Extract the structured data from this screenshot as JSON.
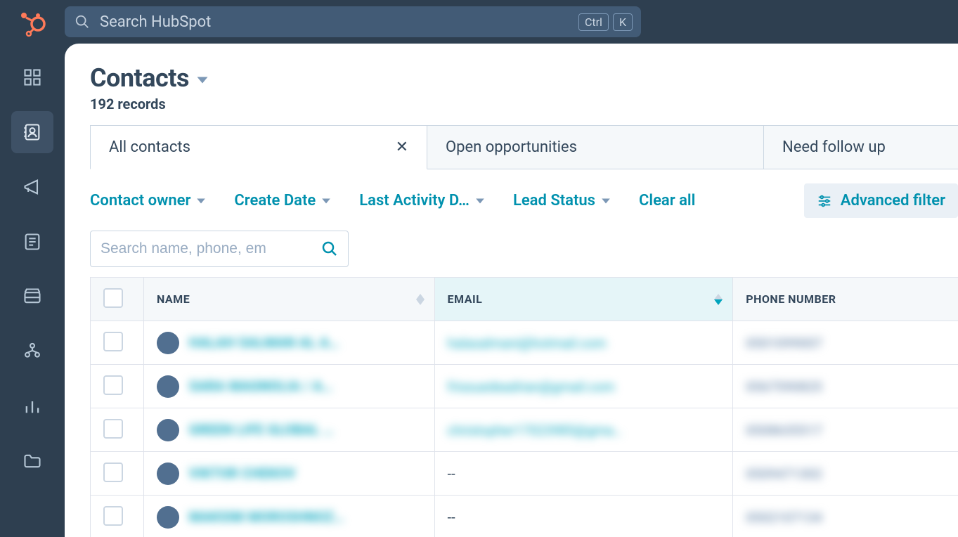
{
  "search": {
    "placeholder": "Search HubSpot",
    "kbd1": "Ctrl",
    "kbd2": "K"
  },
  "page": {
    "title": "Contacts",
    "record_count": "192 records"
  },
  "tabs": [
    {
      "label": "All contacts",
      "closable": true,
      "active": true
    },
    {
      "label": "Open opportunities",
      "closable": false,
      "active": false
    },
    {
      "label": "Need follow up",
      "closable": false,
      "active": false
    }
  ],
  "filters": {
    "f1": "Contact owner",
    "f2": "Create Date",
    "f3": "Last Activity D…",
    "f4": "Lead Status",
    "clear": "Clear all",
    "advanced": "Advanced filter"
  },
  "table_search_placeholder": "Search name, phone, em",
  "columns": {
    "name": "NAME",
    "email": "EMAIL",
    "phone": "PHONE NUMBER"
  },
  "rows": [
    {
      "name": "HALAH SALMAN AL A…",
      "email": "halasalmani@hotmail.com",
      "phone": "0501099007"
    },
    {
      "name": "SARA MAGNOLIA / A…",
      "email": "frissuedeadrian@gmail.com",
      "phone": "0567590825"
    },
    {
      "name": "GREEN LIFE GLOBAL …",
      "email": "christopher17023985@gma…",
      "phone": "0508635517"
    },
    {
      "name": "VIKTOR CHEKOV",
      "email": "--",
      "phone": "0509471302"
    },
    {
      "name": "MAKSIM MOROSHNOZ…",
      "email": "--",
      "phone": "0502107134"
    }
  ]
}
